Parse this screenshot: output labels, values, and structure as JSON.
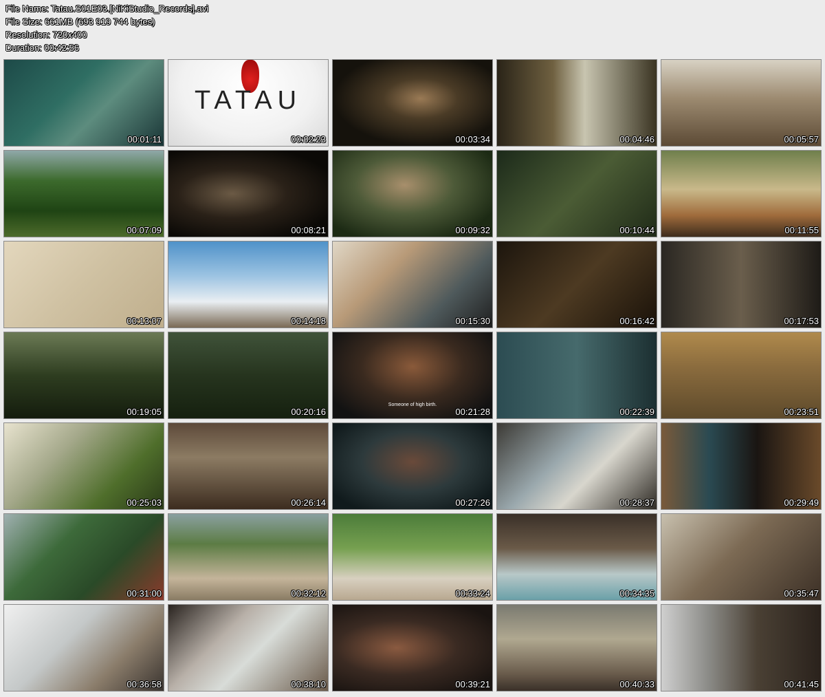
{
  "file_info": {
    "name": "File Name: Tatau.S01E03.[NiKiStudio_Records].avi",
    "size": "File Size: 661MB (693 919 744 bytes)",
    "resolution": "Resolution: 720x400",
    "duration": "Duration: 00:42:56"
  },
  "thumbnails": [
    {
      "time": "00:01:11",
      "bg": "linear-gradient(135deg,#1d4a48 0%,#2f6e63 40%,#5d8c7e 60%,#1a3637 100%)"
    },
    {
      "time": "00:02:23",
      "bg": "radial-gradient(ellipse at 50% 30%,#ffffff 0%,#f1f1f1 60%,#d9d9d9 100%)",
      "title": "TATAU"
    },
    {
      "time": "00:03:34",
      "bg": "radial-gradient(ellipse at 55% 45%,#9a7a55 0%,#4a3b26 30%,#15120c 70%)"
    },
    {
      "time": "00:04:46",
      "bg": "linear-gradient(90deg,#2a2418 0%,#6f6040 35%,#c8c5b0 55%,#3a3422 100%)"
    },
    {
      "time": "00:05:57",
      "bg": "linear-gradient(180deg,#d8d2c4 0%,#9c8a70 45%,#5c4a35 100%)"
    },
    {
      "time": "00:07:09",
      "bg": "linear-gradient(180deg,#8fa8a8 0%,#3c6a2c 35%,#1f4414 70%,#4d6b2a 100%)"
    },
    {
      "time": "00:08:21",
      "bg": "radial-gradient(ellipse at 40% 50%,#6b5a45 0%,#2a2118 40%,#0b0906 80%)"
    },
    {
      "time": "00:09:32",
      "bg": "radial-gradient(ellipse at 45% 40%,#a88f6c 0%,#4d5a38 40%,#1c2a14 80%)"
    },
    {
      "time": "00:10:44",
      "bg": "linear-gradient(135deg,#1c2a1a 0%,#4b5c35 50%,#202b18 100%)"
    },
    {
      "time": "00:11:55",
      "bg": "linear-gradient(180deg,#6f7f4c 0%,#c9b98a 45%,#a06c3c 75%,#3e2c1c 100%)"
    },
    {
      "time": "00:13:07",
      "bg": "linear-gradient(135deg,#e3d7bd 0%,#cfc1a2 50%,#bfae8c 100%)"
    },
    {
      "time": "00:14:18",
      "bg": "linear-gradient(180deg,#4f92c9 0%,#9cc3e2 40%,#e9eef2 70%,#7a6a55 100%)"
    },
    {
      "time": "00:15:30",
      "bg": "linear-gradient(135deg,#e0d7c6 0%,#b89a78 35%,#4f5a5c 70%,#1f1f1f 100%)"
    },
    {
      "time": "00:16:42",
      "bg": "linear-gradient(135deg,#1c150d 0%,#4d3a22 50%,#1a1209 100%)"
    },
    {
      "time": "00:17:53",
      "bg": "linear-gradient(90deg,#2a2722 0%,#6a5e4c 50%,#1e1b17 100%)"
    },
    {
      "time": "00:19:05",
      "bg": "linear-gradient(180deg,#6b7a55 0%,#2e3d20 50%,#141c0d 100%)"
    },
    {
      "time": "00:20:16",
      "bg": "linear-gradient(180deg,#40533a 0%,#26341e 50%,#15200f 100%)"
    },
    {
      "time": "00:21:28",
      "bg": "radial-gradient(ellipse at 50% 40%,#8a5a3a 0%,#3a2a1f 45%,#121212 85%)",
      "subtitle": "Someone of high birth."
    },
    {
      "time": "00:22:39",
      "bg": "linear-gradient(90deg,#2c4c52 0%,#466a6c 50%,#1c2f31 100%)"
    },
    {
      "time": "00:23:51",
      "bg": "linear-gradient(180deg,#b08a4c 0%,#8b6c3e 40%,#5e4a2b 100%)"
    },
    {
      "time": "00:25:03",
      "bg": "linear-gradient(135deg,#e8e3cf 0%,#a4a88a 35%,#4f6e2b 70%,#2a3a18 100%)"
    },
    {
      "time": "00:26:14",
      "bg": "linear-gradient(180deg,#5d4a3a 0%,#8c7b63 40%,#3c2c1f 100%)"
    },
    {
      "time": "00:27:26",
      "bg": "radial-gradient(ellipse at 50% 45%,#6a4a3a 0%,#2d3a3c 45%,#101a1c 85%)"
    },
    {
      "time": "00:28:37",
      "bg": "linear-gradient(135deg,#3c3a35 0%,#9aa8ad 40%,#d8d6cd 60%,#2f2b25 100%)"
    },
    {
      "time": "00:29:49",
      "bg": "linear-gradient(90deg,#7a5a3a 0%,#2a4a52 30%,#1a1512 60%,#6a4a2a 100%)"
    },
    {
      "time": "00:31:00",
      "bg": "linear-gradient(135deg,#9fb0b0 0%,#3d6a3a 35%,#2a4a28 65%,#8a3a2c 100%)"
    },
    {
      "time": "00:32:12",
      "bg": "linear-gradient(180deg,#8aa0a0 0%,#5c7c44 35%,#c4b49a 75%,#8a7c64 100%)"
    },
    {
      "time": "00:33:24",
      "bg": "linear-gradient(180deg,#4c7c3a 0%,#76a050 40%,#d8d0c0 75%,#b8a890 100%)"
    },
    {
      "time": "00:34:35",
      "bg": "linear-gradient(180deg,#3a3028 0%,#6a5a48 40%,#b8c8c8 70%,#6aa0a8 100%)"
    },
    {
      "time": "00:35:47",
      "bg": "linear-gradient(135deg,#c8c0ae 0%,#7c6a54 45%,#3c3026 100%)"
    },
    {
      "time": "00:36:58",
      "bg": "linear-gradient(135deg,#f0f0f0 0%,#c4c8c8 40%,#8a7c6a 70%,#3a3430 100%)"
    },
    {
      "time": "00:38:10",
      "bg": "linear-gradient(135deg,#2a2420 0%,#b8b0a8 35%,#d8dcd8 55%,#6a5a4a 100%)"
    },
    {
      "time": "00:39:21",
      "bg": "radial-gradient(ellipse at 40% 50%,#8a5a40 0%,#3a2a22 45%,#1a1411 85%)"
    },
    {
      "time": "00:40:33",
      "bg": "linear-gradient(180deg,#7a7a70 0%,#b0a890 40%,#6a5c4c 80%,#3a3028 100%)"
    },
    {
      "time": "00:41:45",
      "bg": "linear-gradient(90deg,#cfcfcf 0%,#8a8a86 30%,#4a4034 60%,#2a221c 100%)"
    }
  ]
}
